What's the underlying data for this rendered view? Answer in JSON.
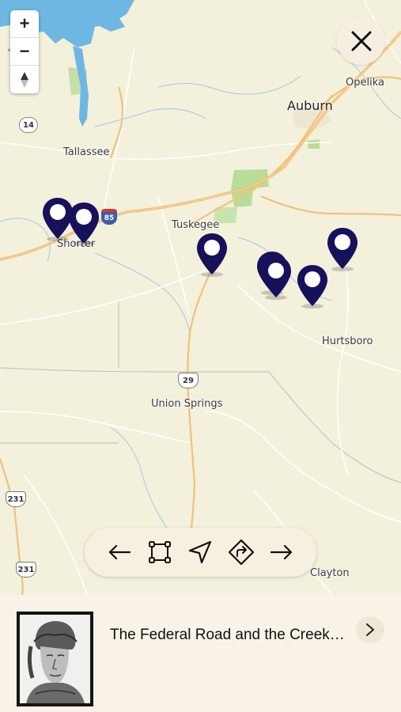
{
  "map": {
    "places": [
      {
        "id": "opelika",
        "name": "Opelika"
      },
      {
        "id": "auburn",
        "name": "Auburn"
      },
      {
        "id": "tallassee",
        "name": "Tallassee"
      },
      {
        "id": "tuskegee",
        "name": "Tuskegee"
      },
      {
        "id": "shorter",
        "name": "Shorter"
      },
      {
        "id": "hurtsboro",
        "name": "Hurtsboro"
      },
      {
        "id": "union-springs",
        "name": "Union Springs"
      },
      {
        "id": "clayton",
        "name": "Clayton"
      }
    ],
    "shields": [
      {
        "id": "al14",
        "label": "14",
        "kind": "state"
      },
      {
        "id": "i85",
        "label": "85",
        "kind": "interstate"
      },
      {
        "id": "us29",
        "label": "29",
        "kind": "us"
      },
      {
        "id": "us231a",
        "label": "231",
        "kind": "us"
      },
      {
        "id": "us231b",
        "label": "231",
        "kind": "us"
      }
    ],
    "zoom": {
      "in": "+",
      "out": "−",
      "compass": "▲"
    },
    "pin_color": "#17105a",
    "pin_count": 7
  },
  "toolbar": {
    "tools": [
      "previous-arrow",
      "fit-bounds",
      "my-location",
      "directions",
      "next-arrow"
    ]
  },
  "card": {
    "title": "The Federal Road and the Creek Indians"
  },
  "colors": {
    "land": "#f3f0dc",
    "water": "#6fb7e3",
    "park": "#b6d992",
    "road": "#f0c27a",
    "panel": "#f8f2e7"
  }
}
